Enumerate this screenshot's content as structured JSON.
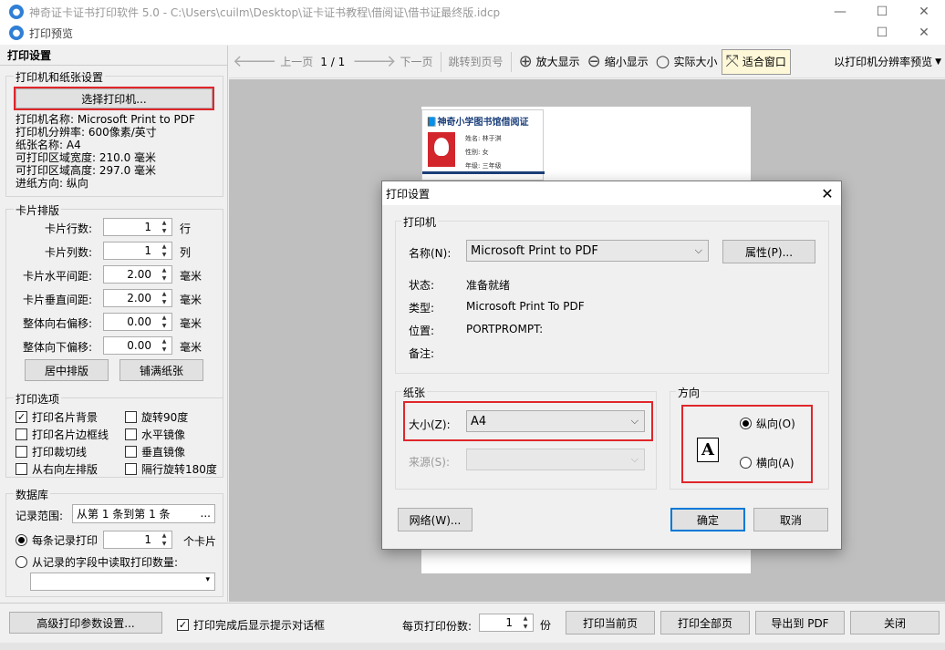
{
  "app_window": {
    "title": "神奇证卡证书打印软件 5.0 - C:\\Users\\cuilm\\Desktop\\证卡证书教程\\借阅证\\借书证最终版.idcp"
  },
  "preview_window": {
    "title": "打印预览"
  },
  "left_panel": {
    "header": "打印设置",
    "printer_group": {
      "title": "打印机和纸张设置",
      "select_printer_label": "选择打印机...",
      "info": [
        "打印机名称: Microsoft Print to PDF",
        "打印机分辨率: 600像素/英寸",
        "纸张名称: A4",
        "可打印区域宽度: 210.0 毫米",
        "可打印区域高度: 297.0 毫米",
        "进纸方向: 纵向"
      ]
    },
    "layout_group": {
      "title": "卡片排版",
      "rows": [
        {
          "label": "卡片行数:",
          "value": "1",
          "unit": "行"
        },
        {
          "label": "卡片列数:",
          "value": "1",
          "unit": "列"
        },
        {
          "label": "卡片水平间距:",
          "value": "2.00",
          "unit": "毫米"
        },
        {
          "label": "卡片垂直间距:",
          "value": "2.00",
          "unit": "毫米"
        },
        {
          "label": "整体向右偏移:",
          "value": "0.00",
          "unit": "毫米"
        },
        {
          "label": "整体向下偏移:",
          "value": "0.00",
          "unit": "毫米"
        }
      ],
      "center_button": "居中排版",
      "fill_button": "铺满纸张"
    },
    "options_group": {
      "title": "打印选项",
      "checkboxes": [
        {
          "label": "打印名片背景",
          "checked": true
        },
        {
          "label": "旋转90度",
          "checked": false
        },
        {
          "label": "打印名片边框线",
          "checked": false
        },
        {
          "label": "水平镜像",
          "checked": false
        },
        {
          "label": "打印裁切线",
          "checked": false
        },
        {
          "label": "垂直镜像",
          "checked": false
        },
        {
          "label": "从右向左排版",
          "checked": false
        },
        {
          "label": "隔行旋转180度",
          "checked": false
        }
      ]
    },
    "database_group": {
      "title": "数据库",
      "range_label": "记录范围:",
      "range_value": "从第 1 条到第 1 条",
      "range_button": "...",
      "per_record_label": "每条记录打印",
      "per_record_value": "1",
      "per_record_unit": "个卡片",
      "from_field_label": "从记录的字段中读取打印数量:"
    }
  },
  "toolbar": {
    "prev_page": "上一页",
    "page_indicator": "1 / 1",
    "next_page": "下一页",
    "goto_page": "跳转到页号",
    "zoom_in": "放大显示",
    "zoom_out": "缩小显示",
    "actual_size": "实际大小",
    "fit_window": "适合窗口",
    "resolution_preview": "以打印机分辨率预览"
  },
  "card_preview": {
    "title": "神奇小学图书馆借阅证",
    "fields": [
      "姓名:  林于淇",
      "性别:  女",
      "年级:  三年级"
    ]
  },
  "dialog": {
    "title": "打印设置",
    "printer_section": "打印机",
    "name_label": "名称(N):",
    "name_value": "Microsoft Print to PDF",
    "properties_button": "属性(P)...",
    "status_label": "状态:",
    "status_value": "准备就绪",
    "type_label": "类型:",
    "type_value": "Microsoft Print To PDF",
    "location_label": "位置:",
    "location_value": "PORTPROMPT:",
    "comment_label": "备注:",
    "paper_section": "纸张",
    "size_label": "大小(Z):",
    "size_value": "A4",
    "source_label": "来源(S):",
    "orientation_section": "方向",
    "portrait_label": "纵向(O)",
    "landscape_label": "横向(A)",
    "orientation_icon_letter": "A",
    "network_button": "网络(W)...",
    "ok_button": "确定",
    "cancel_button": "取消"
  },
  "bottom_bar": {
    "advanced_button": "高级打印参数设置...",
    "show_prompt_label": "打印完成后显示提示对话框",
    "show_prompt_checked": true,
    "copies_label": "每页打印份数:",
    "copies_value": "1",
    "copies_unit": "份",
    "print_current": "打印当前页",
    "print_all": "打印全部页",
    "export_pdf": "导出到 PDF",
    "close": "关闭"
  },
  "colors": {
    "highlight_red": "#e0262b",
    "primary_blue": "#0078d7",
    "preview_gray": "#bfbfbf"
  }
}
